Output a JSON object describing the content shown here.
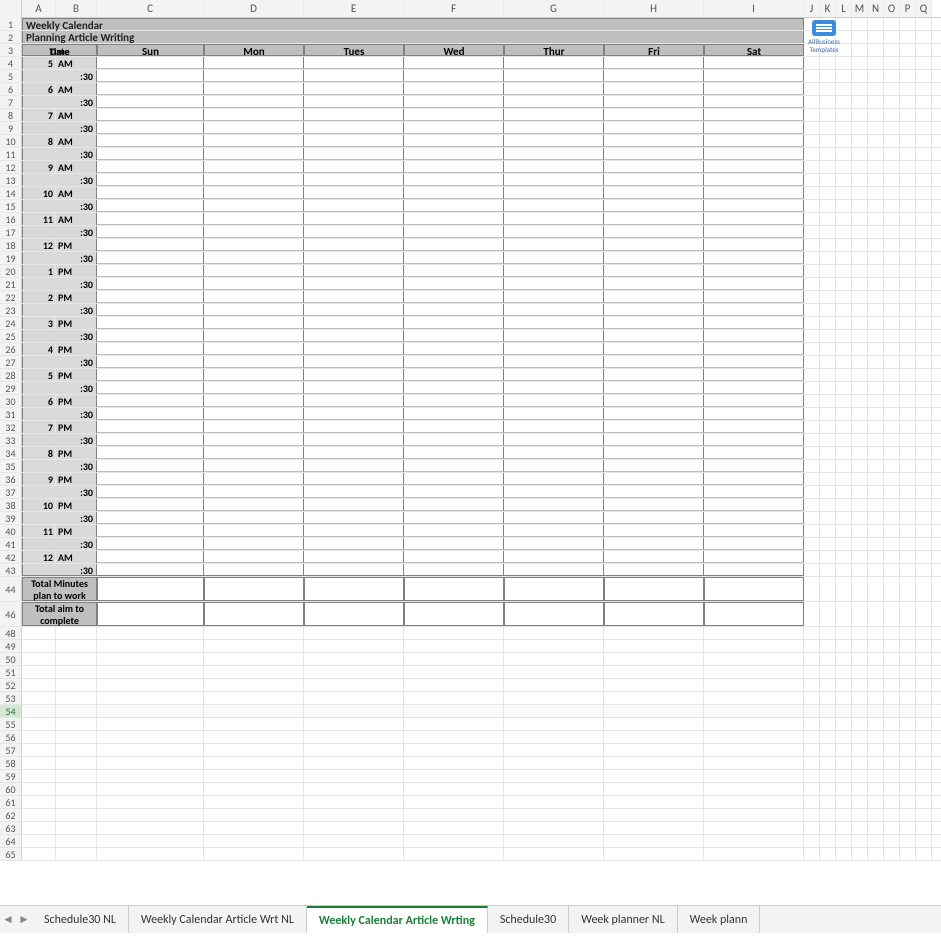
{
  "columns": [
    "A",
    "B",
    "C",
    "D",
    "E",
    "F",
    "G",
    "H",
    "I",
    "J",
    "K",
    "L",
    "M",
    "N",
    "O",
    "P",
    "Q"
  ],
  "title1": "Weekly Calendar",
  "title2": "Planning Article Writing",
  "labels": {
    "date": "Date",
    "time": "Time"
  },
  "days": [
    "Sun",
    "Mon",
    "Tues",
    "Wed",
    "Thur",
    "Fri",
    "Sat"
  ],
  "time_rows": [
    {
      "row": 4,
      "a": "5",
      "b": "AM"
    },
    {
      "row": 5,
      "half": ":30"
    },
    {
      "row": 6,
      "a": "6",
      "b": "AM"
    },
    {
      "row": 7,
      "half": ":30"
    },
    {
      "row": 8,
      "a": "7",
      "b": "AM"
    },
    {
      "row": 9,
      "half": ":30"
    },
    {
      "row": 10,
      "a": "8",
      "b": "AM"
    },
    {
      "row": 11,
      "half": ":30"
    },
    {
      "row": 12,
      "a": "9",
      "b": "AM"
    },
    {
      "row": 13,
      "half": ":30"
    },
    {
      "row": 14,
      "a": "10",
      "b": "AM"
    },
    {
      "row": 15,
      "half": ":30"
    },
    {
      "row": 16,
      "a": "11",
      "b": "AM"
    },
    {
      "row": 17,
      "half": ":30"
    },
    {
      "row": 18,
      "a": "12",
      "b": "PM"
    },
    {
      "row": 19,
      "half": ":30"
    },
    {
      "row": 20,
      "a": "1",
      "b": "PM"
    },
    {
      "row": 21,
      "half": ":30"
    },
    {
      "row": 22,
      "a": "2",
      "b": "PM"
    },
    {
      "row": 23,
      "half": ":30"
    },
    {
      "row": 24,
      "a": "3",
      "b": "PM"
    },
    {
      "row": 25,
      "half": ":30"
    },
    {
      "row": 26,
      "a": "4",
      "b": "PM"
    },
    {
      "row": 27,
      "half": ":30"
    },
    {
      "row": 28,
      "a": "5",
      "b": "PM"
    },
    {
      "row": 29,
      "half": ":30"
    },
    {
      "row": 30,
      "a": "6",
      "b": "PM"
    },
    {
      "row": 31,
      "half": ":30"
    },
    {
      "row": 32,
      "a": "7",
      "b": "PM"
    },
    {
      "row": 33,
      "half": ":30"
    },
    {
      "row": 34,
      "a": "8",
      "b": "PM"
    },
    {
      "row": 35,
      "half": ":30"
    },
    {
      "row": 36,
      "a": "9",
      "b": "PM"
    },
    {
      "row": 37,
      "half": ":30"
    },
    {
      "row": 38,
      "a": "10",
      "b": "PM"
    },
    {
      "row": 39,
      "half": ":30"
    },
    {
      "row": 40,
      "a": "11",
      "b": "PM"
    },
    {
      "row": 41,
      "half": ":30"
    },
    {
      "row": 42,
      "a": "12",
      "b": "AM"
    },
    {
      "row": 43,
      "half": ":30"
    }
  ],
  "totals": {
    "row1_num": 44,
    "row1_label": "Total Minutes plan to work",
    "row2_num": 46,
    "row2_label": "Total aim to complete"
  },
  "empty_rows": [
    48,
    49,
    50,
    51,
    52,
    53,
    54,
    55,
    56,
    57,
    58,
    59,
    60,
    61,
    62,
    63,
    64,
    65
  ],
  "selected_row": 54,
  "logo": {
    "line1": "AllBusiness",
    "line2": "Templates"
  },
  "sheet_tabs": [
    {
      "label": "Schedule30 NL",
      "active": false
    },
    {
      "label": "Weekly Calendar Article Wrt NL",
      "active": false
    },
    {
      "label": "Weekly Calendar Article Wrting",
      "active": true
    },
    {
      "label": "Schedule30",
      "active": false
    },
    {
      "label": "Week planner NL",
      "active": false
    },
    {
      "label": "Week plann",
      "active": false
    }
  ]
}
